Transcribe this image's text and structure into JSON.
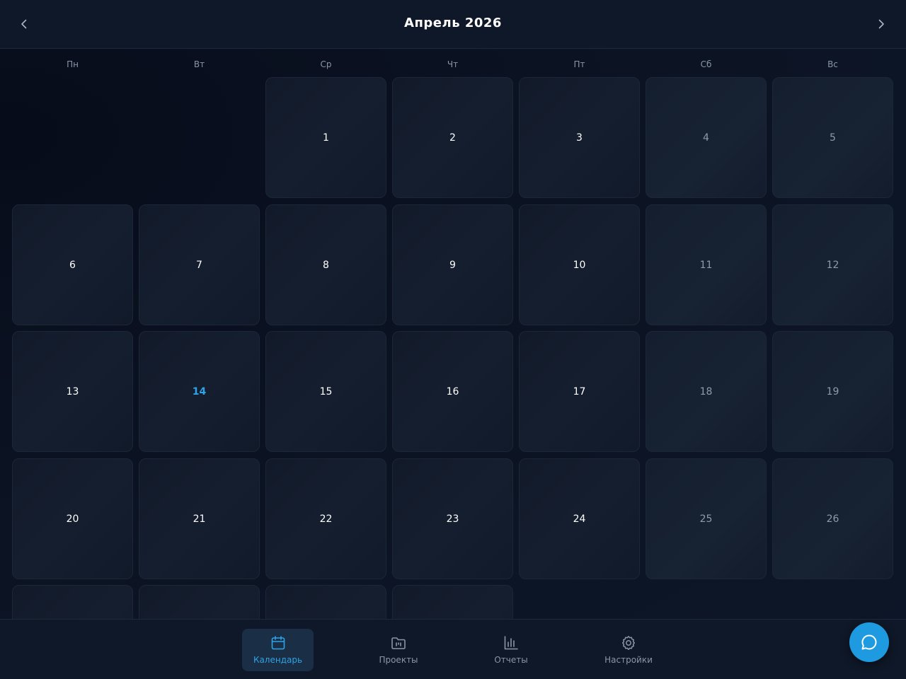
{
  "header": {
    "title": "Апрель 2026",
    "prev_icon": "chevron-left-icon",
    "next_icon": "chevron-right-icon"
  },
  "weekdays": [
    "Пн",
    "Вт",
    "Ср",
    "Чт",
    "Пт",
    "Сб",
    "Вс"
  ],
  "calendar": {
    "first_weekday_index": 2,
    "days_in_month": 30,
    "today": 14,
    "weekend_columns": [
      5,
      6
    ]
  },
  "bottom_nav": {
    "tabs": [
      {
        "label": "Календарь",
        "icon": "calendar-icon",
        "active": true
      },
      {
        "label": "Проекты",
        "icon": "folder-icon",
        "active": false
      },
      {
        "label": "Отчеты",
        "icon": "bar-chart-icon",
        "active": false
      },
      {
        "label": "Настройки",
        "icon": "gear-icon",
        "active": false
      }
    ]
  },
  "fab": {
    "icon": "chat-bubble-icon"
  },
  "colors": {
    "accent": "#2ea3e6",
    "fab": "#1e9be0",
    "background": "#0b1220"
  }
}
